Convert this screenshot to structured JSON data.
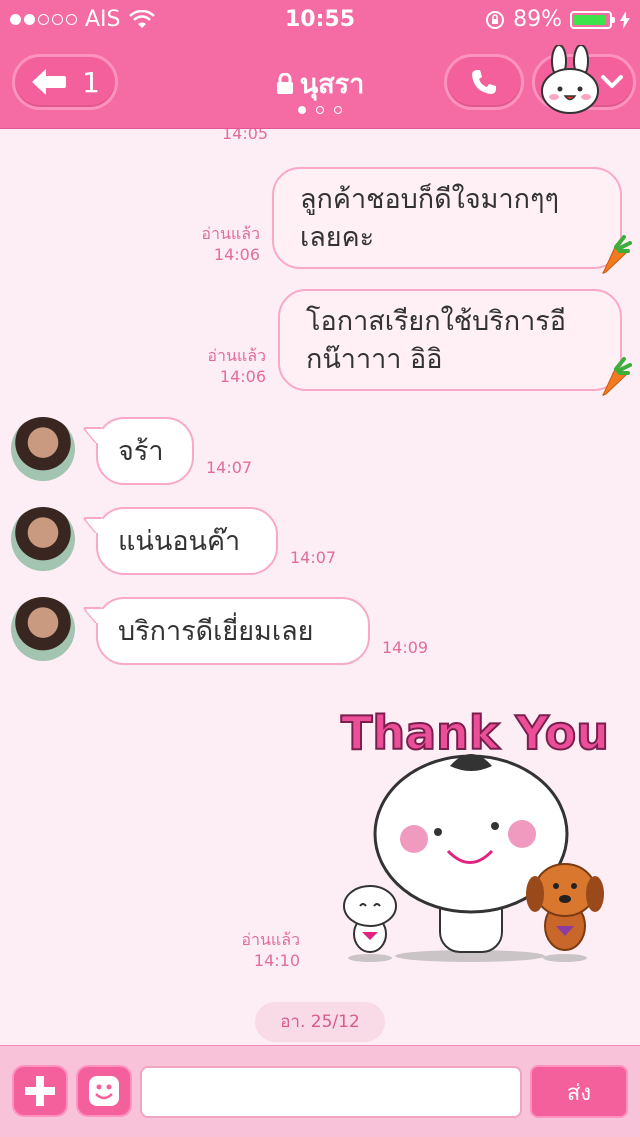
{
  "status": {
    "carrier": "AIS",
    "time": "10:55",
    "battery": "89%"
  },
  "header": {
    "back_count": "1",
    "contact_name": "นุสรา"
  },
  "messages": [
    {
      "time_partial": "14:05"
    },
    {
      "read": "อ่านแล้ว",
      "time": "14:06",
      "line1": "ลูกค้าชอบก็ดีใจมากๆๆ",
      "line2": "เลยคะ"
    },
    {
      "read": "อ่านแล้ว",
      "time": "14:06",
      "line1": "โอกาสเรียกใช้บริการอี",
      "line2": "กน๊าาาา อิอิ"
    },
    {
      "text": "จร้า",
      "time": "14:07"
    },
    {
      "text": "แน่นอนค๊า",
      "time": "14:07"
    },
    {
      "text": "บริการดีเยี่ยมเลย",
      "time": "14:09"
    },
    {
      "read": "อ่านแล้ว",
      "time": "14:10",
      "sticker_text": "Thank You"
    }
  ],
  "date_chip": "อา. 25/12",
  "composer": {
    "send_label": "ส่ง",
    "placeholder": ""
  },
  "colors": {
    "theme": "#f46ca3",
    "bubble_border": "#f8a9c8",
    "timestamp": "#e26d9c"
  }
}
